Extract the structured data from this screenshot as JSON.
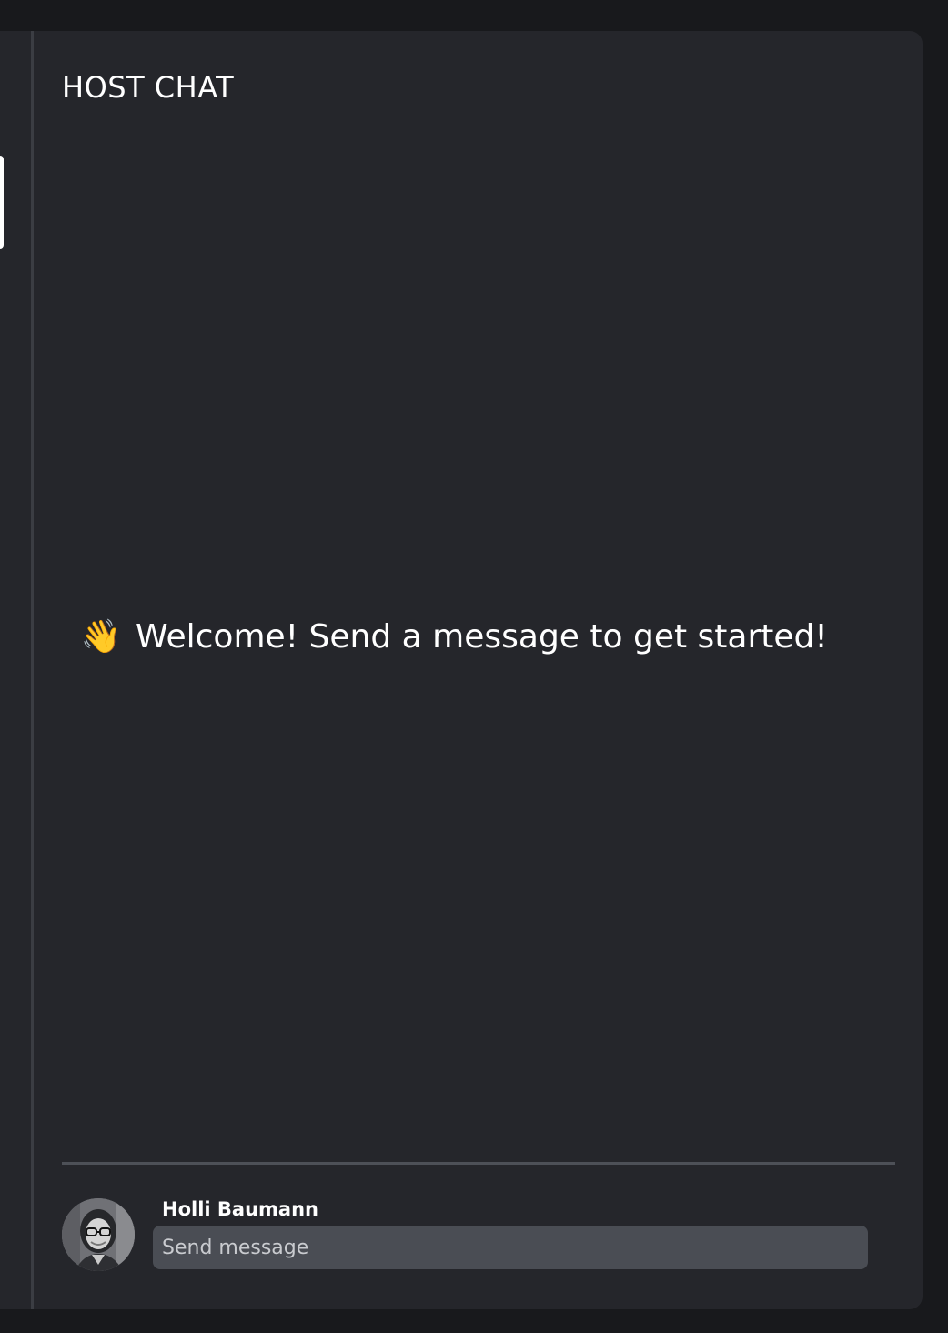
{
  "chat": {
    "title": "HOST CHAT",
    "welcome_text": "Welcome! Send a message to get started!",
    "welcome_icon": "waving-hand-icon"
  },
  "composer": {
    "user_name": "Holli Baumann",
    "placeholder": "Send message"
  },
  "colors": {
    "background": "#18191c",
    "panel": "#25262b",
    "input": "#4a4d54",
    "divider": "#4d5057",
    "text": "#ffffff"
  }
}
